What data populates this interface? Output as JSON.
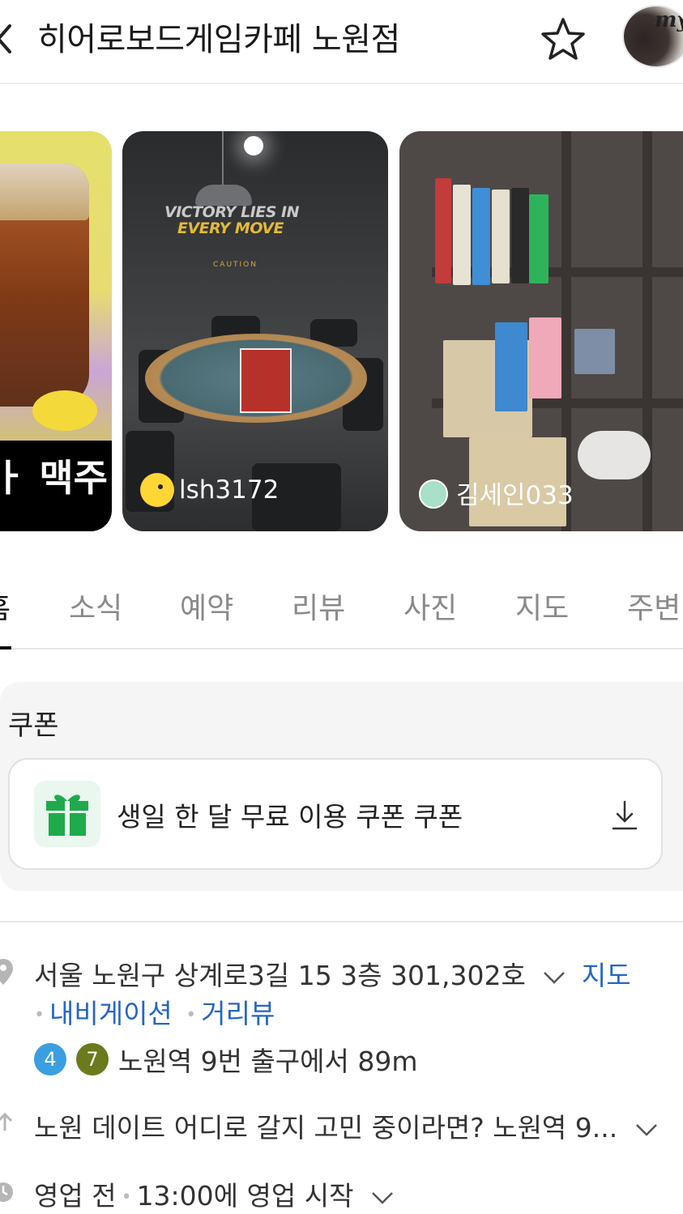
{
  "header": {
    "title": "히어로보드게임카페 노원점",
    "back_icon": "chevron-left-icon",
    "favorite_icon": "star-outline-icon",
    "avatar_text": "my"
  },
  "photos": [
    {
      "overlay_text": "ㅏ 맥주"
    },
    {
      "poster_line1": "VICTORY LIES IN",
      "poster_line2": "EVERY MOVE",
      "caution": "CAUTION",
      "user": "lsh3172"
    },
    {
      "user": "김세인033"
    }
  ],
  "tabs": [
    {
      "label": "홈",
      "active": true
    },
    {
      "label": "소식",
      "active": false
    },
    {
      "label": "예약",
      "active": false
    },
    {
      "label": "리뷰",
      "active": false
    },
    {
      "label": "사진",
      "active": false
    },
    {
      "label": "지도",
      "active": false
    },
    {
      "label": "주변",
      "active": false
    }
  ],
  "coupon": {
    "heading": "쿠폰",
    "item_label": "생일 한 달 무료 이용 쿠폰 쿠폰",
    "icon": "gift-icon",
    "action_icon": "download-icon"
  },
  "info": {
    "address": "서울 노원구 상계로3길 15 3층 301,302호",
    "map_link": "지도",
    "navigation_link": "내비게이션",
    "streetview_link": "거리뷰",
    "subway_lines": [
      {
        "number": "4",
        "color": "#3b9ee0"
      },
      {
        "number": "7",
        "color": "#6b7a1c"
      }
    ],
    "subway_text": "노원역 9번 출구에서 89m",
    "description": "노원 데이트 어디로 갈지 고민 중이라면? 노원역 9...",
    "hours_status": "영업 전",
    "hours_detail": "13:00에 영업 시작"
  },
  "colors": {
    "link": "#2566c6",
    "gift_green": "#1faa4c"
  }
}
